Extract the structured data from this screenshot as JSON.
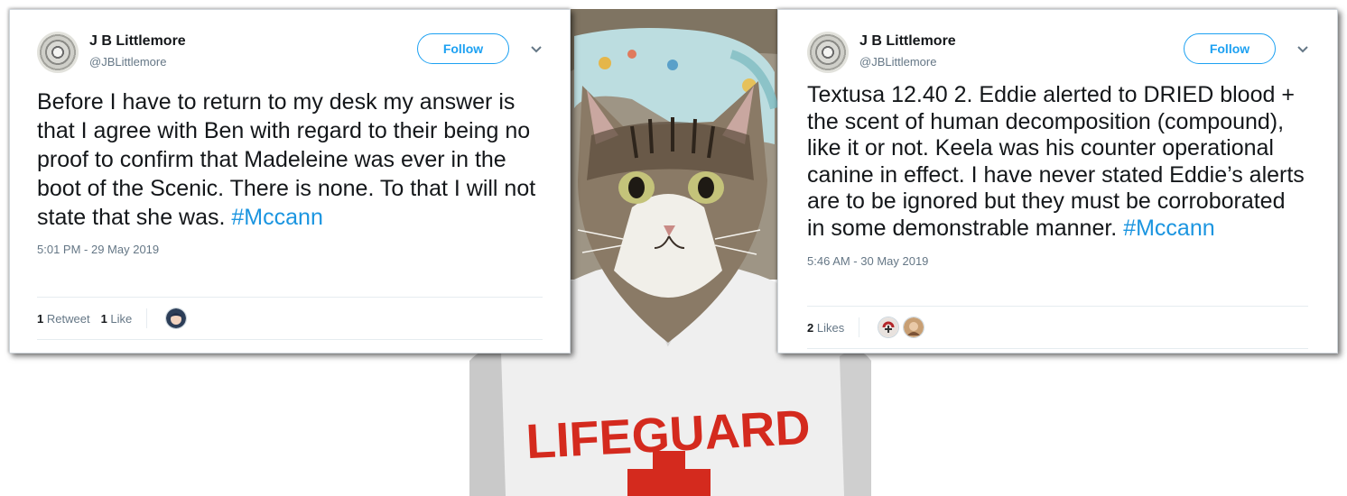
{
  "tweets": [
    {
      "author_name": "J B Littlemore",
      "author_handle": "@JBLittlemore",
      "follow_label": "Follow",
      "text": "Before I have to return to my desk my answer is that I agree with Ben with regard to their being no proof to confirm that Madeleine was ever in the boot of the Scenic. There is none. To that I will not state that she was. ",
      "hashtag": "#Mccann",
      "timestamp": "5:01 PM - 29 May 2019",
      "retweet_count": "1",
      "retweet_label": "Retweet",
      "like_count": "1",
      "like_label": "Like"
    },
    {
      "author_name": "J B Littlemore",
      "author_handle": "@JBLittlemore",
      "follow_label": "Follow",
      "text": "Textusa 12.40 2. Eddie alerted to DRIED blood + the scent of human decomposition (compound), like it or not. Keela was his counter operational canine in effect. I have never stated Eddie’s alerts are to be ignored but they must be corroborated in some demonstrable manner. ",
      "hashtag": "#Mccann",
      "timestamp": "5:46 AM - 30 May 2019",
      "like_count": "2",
      "like_label": "Likes"
    }
  ],
  "shirt_text": "LIFEGUARD",
  "colors": {
    "twitter_blue": "#1da1f2",
    "hashtag_blue": "#1b95e0",
    "shirt_red": "#d42a1e"
  }
}
